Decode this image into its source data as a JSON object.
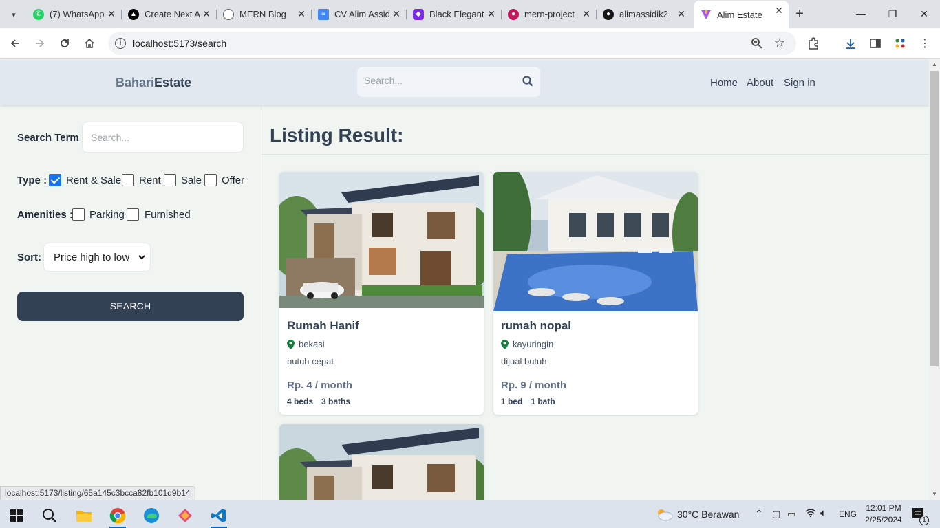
{
  "browser": {
    "tabs": [
      {
        "title": "(7) WhatsApp",
        "icon": "whatsapp-icon",
        "color": "#25d366"
      },
      {
        "title": "Create Next App",
        "icon": "nextjs-icon",
        "color": "#000000"
      },
      {
        "title": "MERN Blog",
        "icon": "globe-icon",
        "color": "#5f6368"
      },
      {
        "title": "CV Alim Assidik",
        "icon": "google-docs-icon",
        "color": "#4285f4"
      },
      {
        "title": "Black Elegant",
        "icon": "canva-icon",
        "color": "#7d2ae8"
      },
      {
        "title": "mern-project",
        "icon": "profile-icon",
        "color": "#c2185b"
      },
      {
        "title": "alimassidik2",
        "icon": "github-icon",
        "color": "#181717"
      },
      {
        "title": "Alim Estate",
        "icon": "vite-icon",
        "color": "#a855f7"
      }
    ],
    "url": "localhost:5173/search",
    "status_url": "localhost:5173/listing/65a145c3bcca82fb101d9b14"
  },
  "header": {
    "logo_first": "Bahari",
    "logo_second": "Estate",
    "search_placeholder": "Search...",
    "nav": [
      "Home",
      "About",
      "Sign in"
    ]
  },
  "filters": {
    "search_term_label": "Search Term :",
    "search_term_placeholder": "Search...",
    "type_label": "Type :",
    "type_options": [
      {
        "label": "Rent & Sale",
        "checked": true
      },
      {
        "label": "Rent",
        "checked": false
      },
      {
        "label": "Sale",
        "checked": false
      },
      {
        "label": "Offer",
        "checked": false
      }
    ],
    "amenities_label": "Amenities :",
    "amenities_options": [
      {
        "label": "Parking",
        "checked": false
      },
      {
        "label": "Furnished",
        "checked": false
      }
    ],
    "sort_label": "Sort:",
    "sort_value": "Price high to low",
    "search_button": "SEARCH"
  },
  "results": {
    "title": "Listing Result:",
    "listings": [
      {
        "name": "Rumah Hanif",
        "location": "bekasi",
        "description": "butuh cepat",
        "price": "Rp. 4 / month",
        "beds": "4 beds",
        "baths": "3 baths"
      },
      {
        "name": "rumah nopal",
        "location": "kayuringin",
        "description": "dijual butuh",
        "price": "Rp. 9 / month",
        "beds": "1 bed",
        "baths": "1 bath"
      }
    ]
  },
  "taskbar": {
    "weather": "30°C  Berawan",
    "language": "ENG",
    "time": "12:01 PM",
    "date": "2/25/2024",
    "notification_count": "1"
  },
  "colors": {
    "header_bg": "#e2e8f0",
    "page_bg": "#f1f5f1",
    "button_bg": "#334155",
    "checkbox_accent": "#1a73e8",
    "location_pin": "#15803d"
  }
}
